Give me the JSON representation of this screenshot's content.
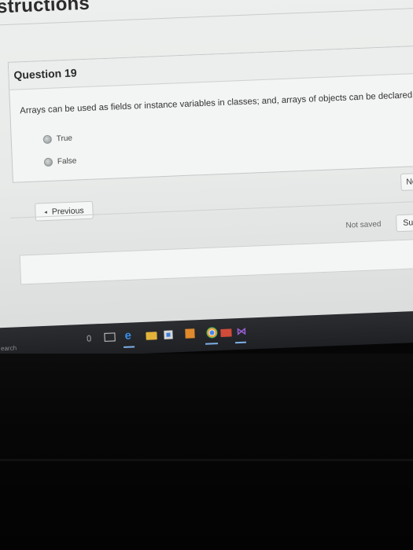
{
  "page": {
    "heading": "structions"
  },
  "question": {
    "title": "Question 19",
    "text": "Arrays can be used as fields or instance variables in classes; and, arrays of objects can be declared.",
    "options": [
      {
        "label": "True"
      },
      {
        "label": "False"
      }
    ]
  },
  "navigation": {
    "next_label": "Next",
    "previous_label": "Previous",
    "submit_label": "Subm",
    "status": "Not saved",
    "previous_chevron": "◂"
  },
  "taskbar": {
    "search_text": "earch",
    "icons": [
      "microphone-icon",
      "task-view-icon",
      "edge-icon",
      "file-explorer-icon",
      "store-icon",
      "app-icon",
      "chrome-icon",
      "mail-icon",
      "visual-studio-icon"
    ],
    "edge_glyph": "e",
    "vs_glyph": "⋈"
  }
}
